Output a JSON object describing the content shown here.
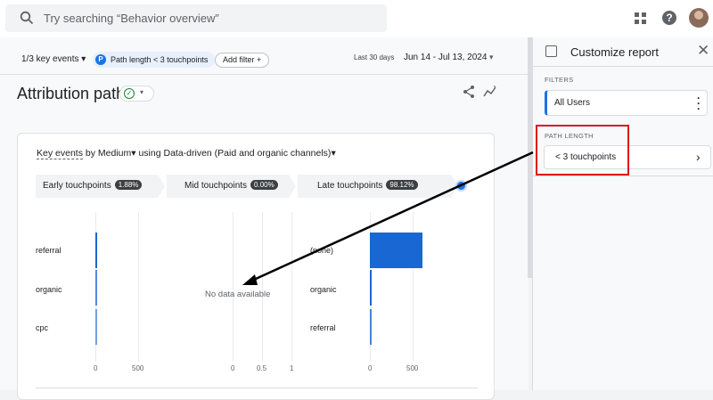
{
  "search": {
    "placeholder": "Try searching “Behavior overview”"
  },
  "filters": {
    "key_events": "1/3 key events",
    "chip_badge": "P",
    "chip_label": "Path length < 3 touchpoints",
    "add_filter": "Add filter"
  },
  "date": {
    "label": "Last 30 days",
    "range": "Jun 14 - Jul 13, 2024"
  },
  "page": {
    "title": "Attribution paths"
  },
  "card": {
    "selector_key": "Key events",
    "selector_by": "by",
    "selector_dim": "Medium",
    "selector_using": "using",
    "selector_model": "Data-driven (Paid and organic channels)",
    "stages": [
      {
        "label": "Early touchpoints",
        "badge": "1.88%"
      },
      {
        "label": "Mid touchpoints",
        "badge": "0.00%"
      },
      {
        "label": "Late touchpoints",
        "badge": "98.12%"
      }
    ],
    "early_rows": [
      "referral",
      "organic",
      "cpc"
    ],
    "late_rows": [
      "(none)",
      "organic",
      "referral"
    ],
    "no_data": "No data available",
    "early_ticks": [
      "0",
      "500"
    ],
    "mid_ticks": [
      "0",
      "0.5",
      "1"
    ],
    "late_ticks": [
      "0",
      "500"
    ]
  },
  "chart_data": [
    {
      "type": "bar",
      "title": "Early touchpoints",
      "categories": [
        "referral",
        "organic",
        "cpc"
      ],
      "values": [
        4,
        2,
        1
      ],
      "xlim": [
        0,
        500
      ]
    },
    {
      "type": "bar",
      "title": "Mid touchpoints",
      "categories": [],
      "values": [],
      "xlim": [
        0,
        1
      ]
    },
    {
      "type": "bar",
      "title": "Late touchpoints",
      "categories": [
        "(none)",
        "organic",
        "referral"
      ],
      "values": [
        470,
        20,
        5
      ],
      "xlim": [
        0,
        500
      ]
    }
  ],
  "panel": {
    "title": "Customize report",
    "filters_label": "FILTERS",
    "filter_value": "All Users",
    "path_label": "PATH LENGTH",
    "path_value": "< 3 touchpoints"
  },
  "colors": {
    "accent": "#1a73e8",
    "bar": "#1967d2",
    "highlight": "#e0141b"
  }
}
